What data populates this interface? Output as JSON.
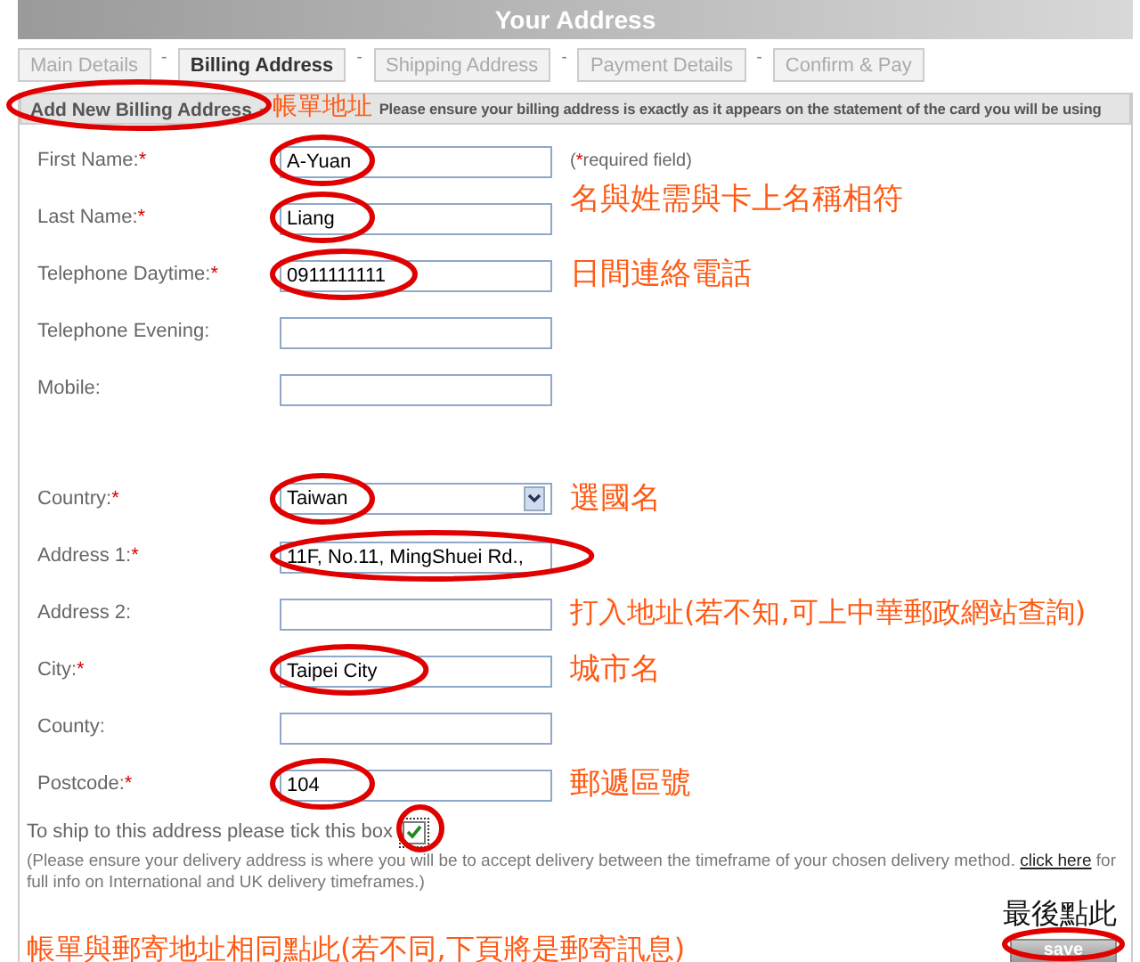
{
  "header": {
    "title": "Your Address"
  },
  "tabs": [
    {
      "label": "Main Details",
      "selected": false
    },
    {
      "label": "Billing Address",
      "selected": true
    },
    {
      "label": "Shipping Address",
      "selected": false
    },
    {
      "label": "Payment Details",
      "selected": false
    },
    {
      "label": "Confirm & Pay",
      "selected": false
    }
  ],
  "tab_separator": "-",
  "section": {
    "title": "Add New Billing Address",
    "title_circled": true,
    "note": "帳單地址",
    "separator": "-",
    "description": "Please ensure your billing address is exactly as it appears on the statement of the card you will be using"
  },
  "required_hint": {
    "open": "(",
    "star": "*",
    "text": "required field)"
  },
  "contact_fields": [
    {
      "label": "First Name:",
      "required_mark": "*",
      "kind": "text",
      "value": "A-Yuan",
      "circled": true
    },
    {
      "label": "Last Name:",
      "required_mark": "*",
      "kind": "text",
      "value": "Liang",
      "circled": true,
      "note": "名與姓需與卡上名稱相符"
    },
    {
      "label": "Telephone Daytime:",
      "required_mark": "*",
      "kind": "text",
      "value": "0911111111",
      "circled": true,
      "note": "日間連絡電話"
    },
    {
      "label": "Telephone Evening:",
      "kind": "text",
      "circled": false
    },
    {
      "label": "Mobile:",
      "kind": "text",
      "circled": false
    }
  ],
  "address_fields": [
    {
      "label": "Country:",
      "required_mark": "*",
      "kind": "select",
      "value": "Taiwan",
      "circled": true,
      "note": "選國名"
    },
    {
      "label": "Address 1:",
      "required_mark": "*",
      "kind": "text",
      "value": "11F, No.11, MingShuei Rd.,",
      "circled": true
    },
    {
      "label": "Address 2:",
      "kind": "text",
      "circled": false,
      "note": "打入地址(若不知,可上中華郵政網站查詢)"
    },
    {
      "label": "City:",
      "required_mark": "*",
      "kind": "text",
      "value": "Taipei City",
      "circled": true,
      "note": "城市名"
    },
    {
      "label": "County:",
      "kind": "text",
      "circled": false
    },
    {
      "label": "Postcode:",
      "required_mark": "*",
      "kind": "text",
      "value": "104",
      "circled": true,
      "note": "郵遞區號"
    }
  ],
  "ship": {
    "text": "To ship to this address please tick this box",
    "checked": true,
    "circled": true,
    "notice_start": "(Please ensure your delivery address is where you will be to accept delivery between the timeframe of your chosen delivery method.",
    "link": "click here",
    "notice_end": "for full info on International and UK delivery timeframes.)",
    "note": "帳單與郵寄地址相同點此(若不同,下頁將是郵寄訊息)"
  },
  "save": {
    "label": "save",
    "circled": true,
    "note": "最後點此"
  }
}
